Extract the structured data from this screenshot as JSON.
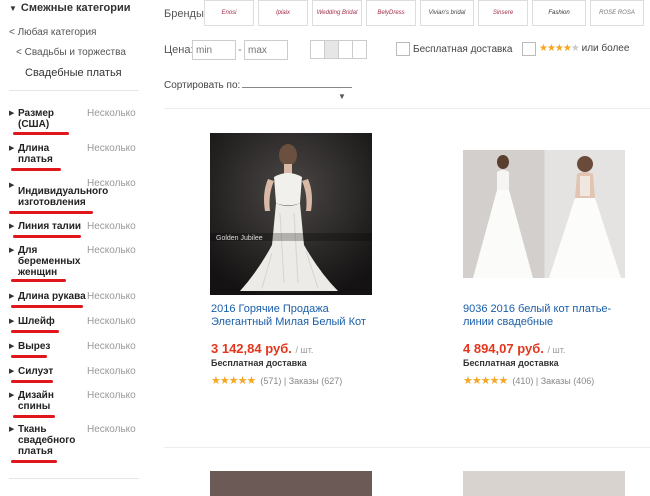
{
  "sidebar": {
    "header": "Смежные категории",
    "any_category": "< Любая категория",
    "wedding": "< Свадьбы и торжества",
    "current": "Свадебные платья",
    "filters": [
      {
        "label": "Размер (США)",
        "state": "Несколько"
      },
      {
        "label": "Длина платья",
        "state": "Несколько"
      },
      {
        "label": "Индивидуального изготовления",
        "state": "Несколько"
      },
      {
        "label": "Линия талии",
        "state": "Несколько"
      },
      {
        "label": "Для беременных женщин",
        "state": "Несколько"
      },
      {
        "label": "Длина рукава",
        "state": "Несколько"
      },
      {
        "label": "Шлейф",
        "state": "Несколько"
      },
      {
        "label": "Вырез",
        "state": "Несколько"
      },
      {
        "label": "Силуэт",
        "state": "Несколько"
      },
      {
        "label": "Дизайн спины",
        "state": "Несколько"
      },
      {
        "label": "Ткань свадебного платья",
        "state": "Несколько"
      }
    ]
  },
  "brands": {
    "label": "Бренды:",
    "items": [
      "Enosi",
      "Iplaix",
      "Wedding Bridal",
      "BelyDress",
      "Vivian's bridal",
      "Sinsere",
      "Fashion",
      "ROSE ROSA"
    ]
  },
  "price": {
    "label": "Цена:",
    "min_placeholder": "min",
    "max_placeholder": "max",
    "dash": "-",
    "free_shipping": "Бесплатная доставка",
    "rating_more": "или более",
    "rating_stars": "★★★★",
    "rating_off": "★"
  },
  "sort": {
    "label": "Сортировать по:",
    "arrow": "▼"
  },
  "products": [
    {
      "title": "2016 Горячие Продажа Элегантный Милая Белый Кот",
      "price": "3 142,84 руб.",
      "unit": "/ шт.",
      "shipping": "Бесплатная доставка",
      "stars": "★★★★★",
      "reviews": "(571)",
      "orders": "Заказы (627)",
      "watermark": "Golden Jubilee"
    },
    {
      "title": "9036 2016 белый кот платье-линии свадебные",
      "price": "4 894,07 руб.",
      "unit": "/ шт.",
      "shipping": "Бесплатная доставка",
      "stars": "★★★★★",
      "reviews": "(410)",
      "orders": "Заказы (406)"
    }
  ],
  "colors": {
    "accent_red": "#e0161d",
    "price": "#e3361c",
    "link": "#1a5ea8",
    "star": "#f5a623"
  }
}
